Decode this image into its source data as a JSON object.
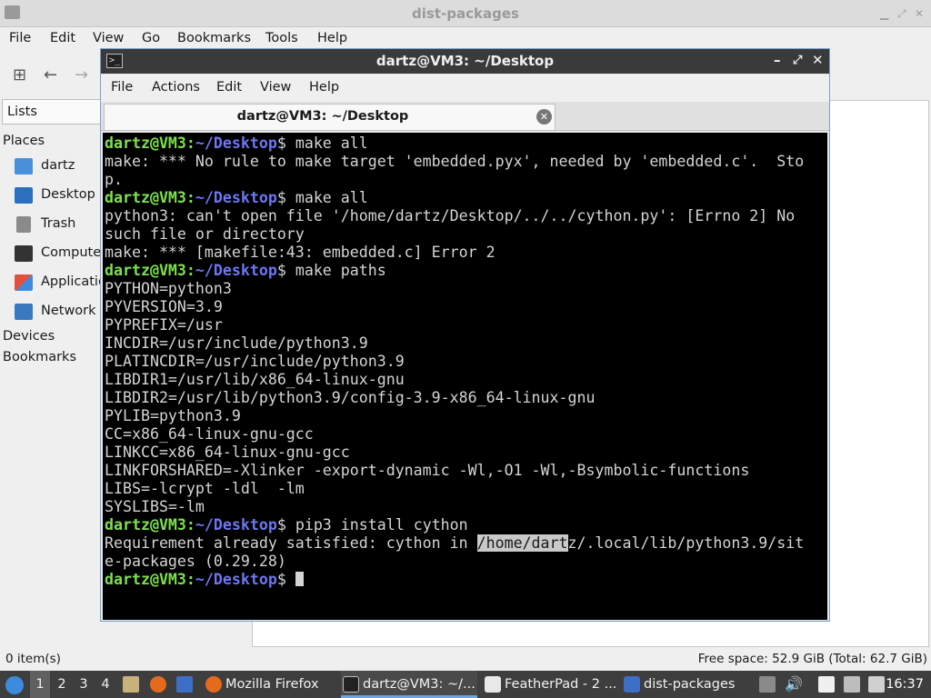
{
  "file_manager": {
    "title": "dist-packages",
    "menu": [
      "File",
      "Edit",
      "View",
      "Go",
      "Bookmarks",
      "Tools",
      "Help"
    ],
    "lists_label": "Lists",
    "places_header": "Places",
    "places": [
      {
        "label": "dartz",
        "icon": "home-folder-icon"
      },
      {
        "label": "Desktop",
        "icon": "desktop-icon"
      },
      {
        "label": "Trash",
        "icon": "trash-icon"
      },
      {
        "label": "Computer",
        "icon": "computer-icon"
      },
      {
        "label": "Applications",
        "icon": "applications-icon"
      },
      {
        "label": "Network",
        "icon": "network-icon"
      }
    ],
    "devices_header": "Devices",
    "bookmarks_header": "Bookmarks",
    "status_items": "0 item(s)",
    "status_free": "Free space: 52.9 GiB (Total: 62.7 GiB)"
  },
  "terminal": {
    "title": "dartz@VM3: ~/Desktop",
    "menu": [
      "File",
      "Actions",
      "Edit",
      "View",
      "Help"
    ],
    "tab_label": "dartz@VM3: ~/Desktop",
    "prompt_user": "dartz@VM3",
    "prompt_path": "~/Desktop",
    "lines": [
      {
        "type": "cmd",
        "text": " make all"
      },
      {
        "type": "out",
        "text": "make: *** No rule to make target 'embedded.pyx', needed by 'embedded.c'.  Sto"
      },
      {
        "type": "out",
        "text": "p."
      },
      {
        "type": "cmd",
        "text": " make all"
      },
      {
        "type": "out",
        "text": "python3: can't open file '/home/dartz/Desktop/../../cython.py': [Errno 2] No"
      },
      {
        "type": "out",
        "text": "such file or directory"
      },
      {
        "type": "out",
        "text": "make: *** [makefile:43: embedded.c] Error 2"
      },
      {
        "type": "cmd",
        "text": " make paths"
      },
      {
        "type": "out",
        "text": "PYTHON=python3"
      },
      {
        "type": "out",
        "text": "PYVERSION=3.9"
      },
      {
        "type": "out",
        "text": "PYPREFIX=/usr"
      },
      {
        "type": "out",
        "text": "INCDIR=/usr/include/python3.9"
      },
      {
        "type": "out",
        "text": "PLATINCDIR=/usr/include/python3.9"
      },
      {
        "type": "out",
        "text": "LIBDIR1=/usr/lib/x86_64-linux-gnu"
      },
      {
        "type": "out",
        "text": "LIBDIR2=/usr/lib/python3.9/config-3.9-x86_64-linux-gnu"
      },
      {
        "type": "out",
        "text": "PYLIB=python3.9"
      },
      {
        "type": "out",
        "text": "CC=x86_64-linux-gnu-gcc"
      },
      {
        "type": "out",
        "text": "LINKCC=x86_64-linux-gnu-gcc"
      },
      {
        "type": "out",
        "text": "LINKFORSHARED=-Xlinker -export-dynamic -Wl,-O1 -Wl,-Bsymbolic-functions"
      },
      {
        "type": "out",
        "text": "LIBS=-lcrypt -ldl  -lm"
      },
      {
        "type": "out",
        "text": "SYSLIBS=-lm"
      },
      {
        "type": "cmd",
        "text": " pip3 install cython"
      },
      {
        "type": "sel",
        "pre": "Requirement already satisfied: cython in ",
        "sel": "/home/dart",
        "post": "z/.local/lib/python3.9/sit"
      },
      {
        "type": "out",
        "text": "e-packages (0.29.28)"
      },
      {
        "type": "prompt",
        "text": " "
      }
    ]
  },
  "taskbar": {
    "workspaces": [
      "1",
      "2",
      "3",
      "4"
    ],
    "tasks": [
      {
        "label": "Mozilla Firefox",
        "icon": "firefox-icon"
      },
      {
        "label": "dartz@VM3: ~/...",
        "icon": "terminal-icon",
        "active": true
      },
      {
        "label": "FeatherPad - 2 ...",
        "icon": "featherpad-icon"
      },
      {
        "label": "dist-packages",
        "icon": "folder-icon"
      }
    ],
    "clock": "16:37"
  },
  "colors": {
    "prompt_user": "#7fe04f",
    "prompt_path": "#6e76f2",
    "terminal_bg": "#000000",
    "taskbar_bg": "#3e3e3e"
  }
}
